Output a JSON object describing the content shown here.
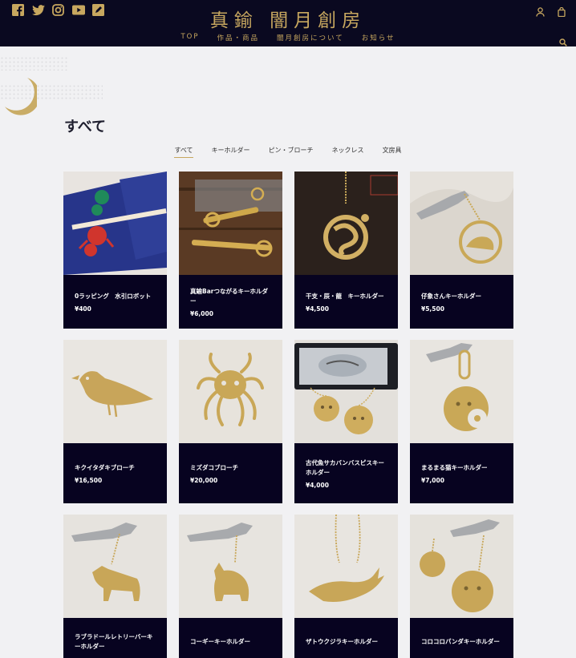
{
  "header": {
    "logo": "真鍮 闇月創房",
    "nav": [
      "TOP",
      "作品・商品",
      "闇月創房について",
      "お知らせ"
    ],
    "social_icons": [
      "facebook-icon",
      "twitter-icon",
      "instagram-icon",
      "youtube-icon",
      "blog-icon"
    ],
    "right_icons": [
      "user-icon",
      "cart-icon",
      "search-icon"
    ]
  },
  "colors": {
    "header_bg": "#0a0920",
    "accent_gold": "#c7a75f",
    "card_info_bg": "#070320",
    "page_bg": "#f1f1f3"
  },
  "page_title": "すべて",
  "categories": [
    "すべて",
    "キーホルダー",
    "ピン・ブローチ",
    "ネックレス",
    "文房具"
  ],
  "active_category": "すべて",
  "products": [
    {
      "name": "0ラッピング　水引ロボット",
      "price": "¥400"
    },
    {
      "name": "真鍮Barつながるキーホルダー",
      "price": "¥6,000"
    },
    {
      "name": "干支・辰・龍　キーホルダー",
      "price": "¥4,500"
    },
    {
      "name": "仔象さんキーホルダー",
      "price": "¥5,500"
    },
    {
      "name": "キクイタダキブローチ",
      "price": "¥16,500"
    },
    {
      "name": "ミズダコブローチ",
      "price": "¥20,000"
    },
    {
      "name": "古代魚サカバンバスピスキーホルダー",
      "price": "¥4,000"
    },
    {
      "name": "まるまる猫キーホルダー",
      "price": "¥7,000"
    },
    {
      "name": "ラブラドールレトリーバーキーホルダー",
      "price": ""
    },
    {
      "name": "コーギーキーホルダー",
      "price": ""
    },
    {
      "name": "ザトウクジラキーホルダー",
      "price": ""
    },
    {
      "name": "コロコロパンダキーホルダー",
      "price": ""
    }
  ]
}
